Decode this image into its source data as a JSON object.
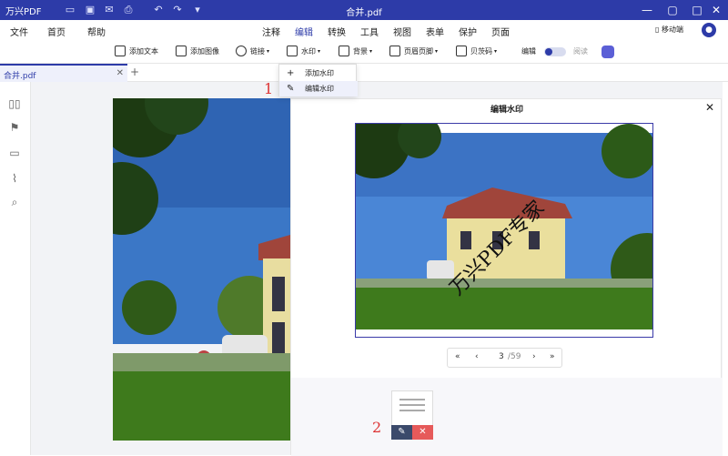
{
  "titlebar": {
    "logo": "万兴PDF",
    "title": "合并.pdf"
  },
  "menu_left": [
    "文件",
    "首页",
    "帮助"
  ],
  "menu_tabs": [
    "注释",
    "编辑",
    "转换",
    "工具",
    "视图",
    "表单",
    "保护",
    "页面"
  ],
  "mobile_label": "移动端",
  "toolbar": {
    "add_text": "添加文本",
    "add_image": "添加图像",
    "link": "链接",
    "watermark": "水印",
    "background": "背景",
    "header_footer": "页眉页脚",
    "bates": "贝茨码",
    "edit_label": "编辑",
    "read_label": "阅读"
  },
  "tab": {
    "name": "合并.pdf"
  },
  "dropdown": {
    "add_watermark": "添加水印",
    "edit_watermark": "编辑水印"
  },
  "annotations": {
    "one": "1",
    "two": "2"
  },
  "dialog": {
    "title": "编辑水印",
    "watermark_text": "万兴PDF专家",
    "pager": {
      "current": "3",
      "total": "/59",
      "first": "«",
      "prev": "‹",
      "next": "›",
      "last": "»"
    }
  },
  "colors": {
    "brand": "#2d3ba8",
    "annotation": "#dd3333"
  }
}
